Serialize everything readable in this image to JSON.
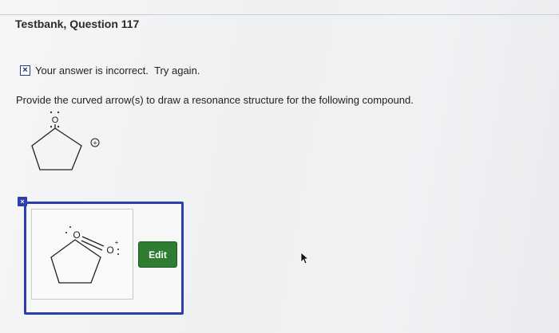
{
  "header": {
    "title": "Testbank, Question 117"
  },
  "feedback": {
    "icon": "incorrect-x-icon",
    "icon_glyph": "×",
    "message": "Your answer is incorrect.",
    "hint": "Try again."
  },
  "question": {
    "prompt": "Provide the curved arrow(s) to draw a resonance structure for the following compound."
  },
  "structure": {
    "atom_label": "O",
    "charge_label": "+"
  },
  "answer": {
    "flag_glyph": "×",
    "atom_label_ring": "O",
    "atom_label_exo": "O",
    "charge_label": "+"
  },
  "toolbar": {
    "edit_label": "Edit"
  },
  "colors": {
    "accent_blue": "#2d3fb0",
    "edit_green": "#2e7d32"
  }
}
